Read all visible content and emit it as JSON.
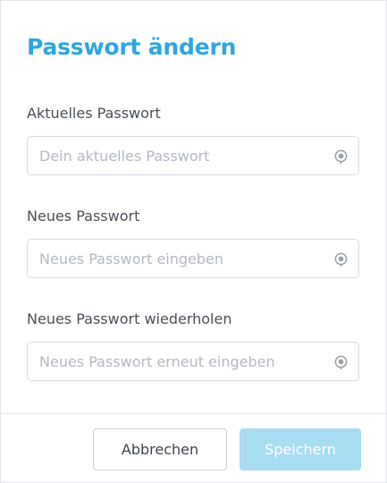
{
  "dialog": {
    "title": "Passwort ändern"
  },
  "fields": {
    "current": {
      "label": "Aktuelles Passwort",
      "placeholder": "Dein aktuelles Passwort",
      "value": ""
    },
    "new": {
      "label": "Neues Passwort",
      "placeholder": "Neues Passwort eingeben",
      "value": ""
    },
    "repeat": {
      "label": "Neues Passwort wiederholen",
      "placeholder": "Neues Passwort erneut eingeben",
      "value": ""
    }
  },
  "icons": {
    "toggle_visibility": "eye-icon"
  },
  "buttons": {
    "cancel": "Abbrechen",
    "save": "Speichern"
  },
  "colors": {
    "accent": "#2ea6df",
    "save_button_disabled": "#a8dcf3"
  }
}
